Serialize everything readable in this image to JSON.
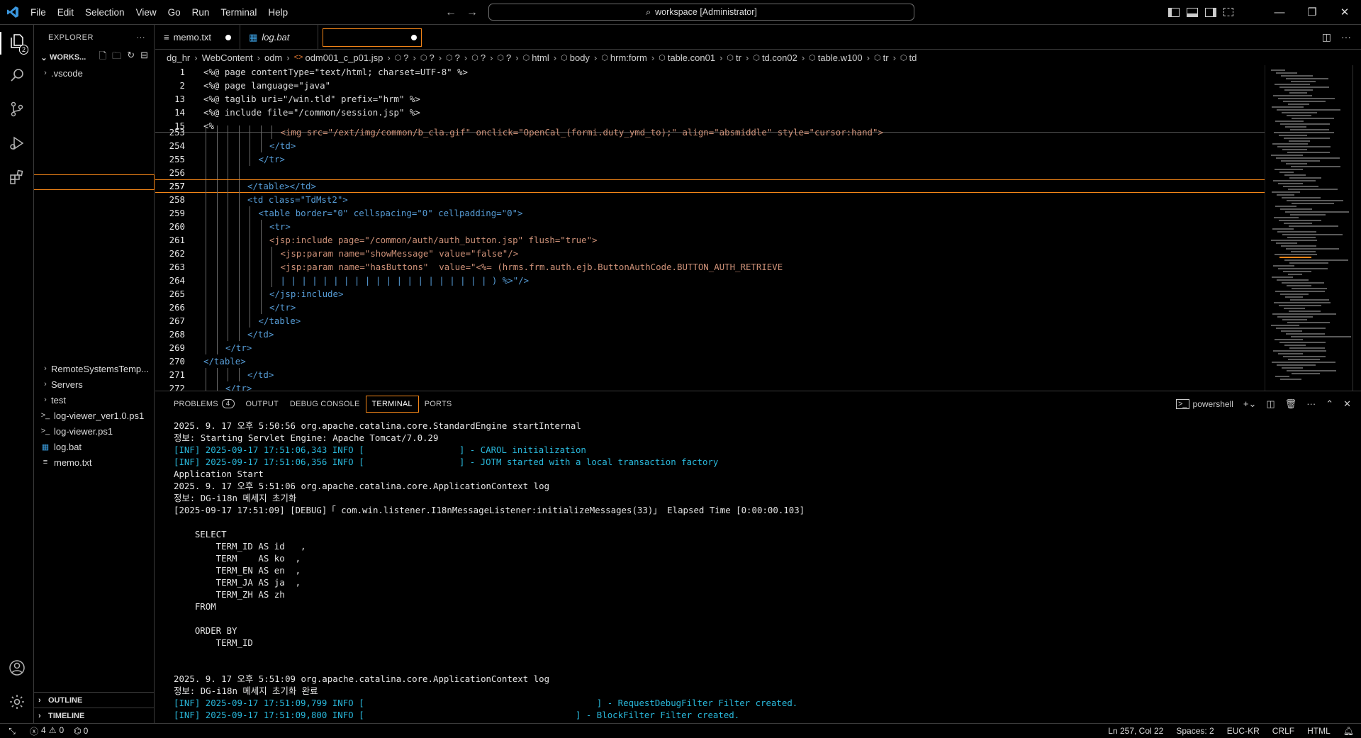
{
  "titlebar": {
    "menu": [
      "File",
      "Edit",
      "Selection",
      "View",
      "Go",
      "Run",
      "Terminal",
      "Help"
    ],
    "command_center": "workspace [Administrator]"
  },
  "activity": {
    "explorer_badge": "2"
  },
  "sidebar": {
    "title": "EXPLORER",
    "workspace": "WORKS...",
    "items_top": [
      {
        "label": ".vscode",
        "type": "folder"
      }
    ],
    "items_bottom": [
      {
        "label": "RemoteSystemsTemp...",
        "type": "folder"
      },
      {
        "label": "Servers",
        "type": "folder"
      },
      {
        "label": "test",
        "type": "folder"
      },
      {
        "label": "log-viewer_ver1.0.ps1",
        "type": "ps1"
      },
      {
        "label": "log-viewer.ps1",
        "type": "ps1"
      },
      {
        "label": "log.bat",
        "type": "bat"
      },
      {
        "label": "memo.txt",
        "type": "txt"
      }
    ],
    "outline": "OUTLINE",
    "timeline": "TIMELINE"
  },
  "tabs": [
    {
      "label": "memo.txt",
      "modified": true
    },
    {
      "label": "log.bat",
      "italic": true
    },
    {
      "label": "",
      "modified": true,
      "active": true
    }
  ],
  "breadcrumbs": [
    "dg_hr",
    "WebContent",
    "odm",
    "odm001_c_p01.jsp",
    "?",
    "?",
    "?",
    "?",
    "?",
    "html",
    "body",
    "hrm:form",
    "table.con01",
    "tr",
    "td.con02",
    "table.w100",
    "tr",
    "td"
  ],
  "editor": {
    "sticky": [
      {
        "ln": "1",
        "code": "<%@ page contentType=\"text/html; charset=UTF-8\" %>"
      },
      {
        "ln": "2",
        "code": "<%@ page language=\"java\""
      },
      {
        "ln": "13",
        "code": "<%@ taglib uri=\"/win.tld\" prefix=\"hrm\" %>"
      },
      {
        "ln": "14",
        "code": "<%@ include file=\"/common/session.jsp\" %>"
      },
      {
        "ln": "15",
        "code": "<%"
      }
    ],
    "lines": [
      {
        "ln": "253",
        "code": "<img src=\"/ext/img/common/b_cla.gif\" onclick=\"OpenCal_(formi.duty_ymd_to);\" align=\"absmiddle\" style=\"cursor:hand\">"
      },
      {
        "ln": "254",
        "code": "</td>"
      },
      {
        "ln": "255",
        "code": "</tr>"
      },
      {
        "ln": "256",
        "code": ""
      },
      {
        "ln": "257",
        "code": "</table></td>"
      },
      {
        "ln": "258",
        "code": "<td class=\"TdMst2\">"
      },
      {
        "ln": "259",
        "code": "<table border=\"0\" cellspacing=\"0\" cellpadding=\"0\">"
      },
      {
        "ln": "260",
        "code": "<tr>"
      },
      {
        "ln": "261",
        "code": "<jsp:include page=\"/common/auth/auth_button.jsp\" flush=\"true\">"
      },
      {
        "ln": "262",
        "code": "<jsp:param name=\"showMessage\" value=\"false\"/>"
      },
      {
        "ln": "263",
        "code": "<jsp:param name=\"hasButtons\"  value=\"<%= (hrms.frm.auth.ejb.ButtonAuthCode.BUTTON_AUTH_RETRIEVE"
      },
      {
        "ln": "264",
        "code": "| | | | | | | | | | | | | | | | | | | | ) %>\"/>"
      },
      {
        "ln": "265",
        "code": "</jsp:include>"
      },
      {
        "ln": "266",
        "code": "</tr>"
      },
      {
        "ln": "267",
        "code": "</table>"
      },
      {
        "ln": "268",
        "code": "</td>"
      },
      {
        "ln": "269",
        "code": "</tr>"
      },
      {
        "ln": "270",
        "code": "</table>"
      },
      {
        "ln": "271",
        "code": "</td>"
      },
      {
        "ln": "272",
        "code": "</tr>"
      }
    ]
  },
  "panel": {
    "tabs": [
      "PROBLEMS",
      "OUTPUT",
      "DEBUG CONSOLE",
      "TERMINAL",
      "PORTS"
    ],
    "problems_count": "4",
    "shell": "powershell",
    "terminal_lines": [
      {
        "text": "2025. 9. 17 오후 5:50:56 org.apache.catalina.core.StandardEngine startInternal",
        "kind": "plain"
      },
      {
        "text": "정보: Starting Servlet Engine: Apache Tomcat/7.0.29",
        "kind": "plain"
      },
      {
        "text": "[INF] 2025-09-17 17:51:06,343 INFO [                  ] - CAROL initialization",
        "kind": "info"
      },
      {
        "text": "[INF] 2025-09-17 17:51:06,356 INFO [                  ] - JOTM started with a local transaction factory",
        "kind": "info"
      },
      {
        "text": "Application Start",
        "kind": "plain"
      },
      {
        "text": "2025. 9. 17 오후 5:51:06 org.apache.catalina.core.ApplicationContext log",
        "kind": "plain"
      },
      {
        "text": "정보: DG-i18n 메세지 초기화",
        "kind": "plain"
      },
      {
        "text": "[2025-09-17 17:51:09] [DEBUG]「 com.win.listener.I18nMessageListener:initializeMessages(33)」 Elapsed Time [0:00:00.103]",
        "kind": "plain"
      },
      {
        "text": "",
        "kind": "plain"
      },
      {
        "text": "    SELECT",
        "kind": "plain"
      },
      {
        "text": "        TERM_ID AS id   ,",
        "kind": "plain"
      },
      {
        "text": "        TERM    AS ko  ,",
        "kind": "plain"
      },
      {
        "text": "        TERM_EN AS en  ,",
        "kind": "plain"
      },
      {
        "text": "        TERM_JA AS ja  ,",
        "kind": "plain"
      },
      {
        "text": "        TERM_ZH AS zh",
        "kind": "plain"
      },
      {
        "text": "    FROM",
        "kind": "plain"
      },
      {
        "text": "",
        "kind": "plain"
      },
      {
        "text": "    ORDER BY",
        "kind": "plain"
      },
      {
        "text": "        TERM_ID",
        "kind": "plain"
      },
      {
        "text": "",
        "kind": "plain"
      },
      {
        "text": "",
        "kind": "plain"
      },
      {
        "text": "2025. 9. 17 오후 5:51:09 org.apache.catalina.core.ApplicationContext log",
        "kind": "plain"
      },
      {
        "text": "정보: DG-i18n 메세지 초기화 완료",
        "kind": "plain"
      },
      {
        "text": "[INF] 2025-09-17 17:51:09,799 INFO [                                            ] - RequestDebugFilter Filter created.",
        "kind": "info"
      },
      {
        "text": "[INF] 2025-09-17 17:51:09,800 INFO [                                        ] - BlockFilter Filter created.",
        "kind": "info"
      }
    ]
  },
  "status": {
    "errors": "4",
    "warnings": "0",
    "ports": "0",
    "position": "Ln 257, Col 22",
    "spaces": "Spaces: 2",
    "encoding": "EUC-KR",
    "eol": "CRLF",
    "language": "HTML"
  },
  "colors": {
    "focus": "#f38518",
    "info": "#29b8db",
    "tag": "#569cd6"
  }
}
